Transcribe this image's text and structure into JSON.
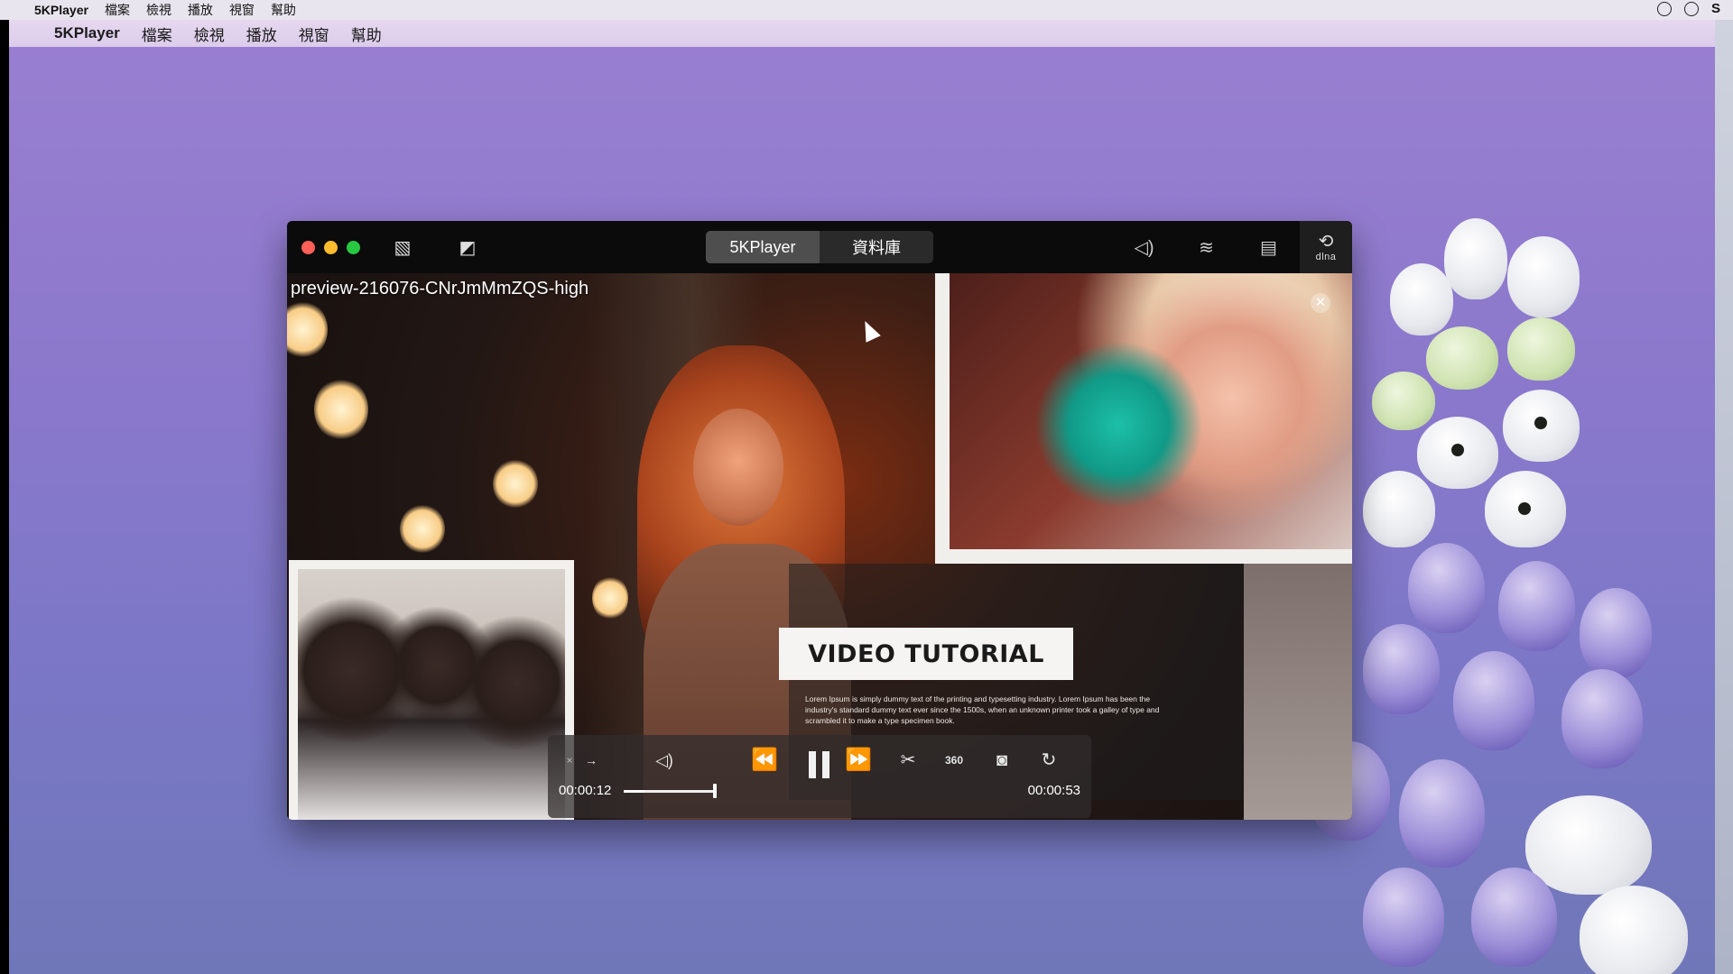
{
  "system_menubar": {
    "apple_icon": "apple-logo-icon",
    "app_name": "5KPlayer",
    "items": [
      "檔案",
      "檢視",
      "播放",
      "視窗",
      "幫助"
    ]
  },
  "inner_menubar": {
    "apple_icon": "apple-logo-icon",
    "app_name": "5KPlayer",
    "items": [
      "檔案",
      "檢視",
      "播放",
      "視窗",
      "幫助"
    ]
  },
  "player": {
    "tabs": [
      "5KPlayer",
      "資料庫"
    ],
    "active_tab": "5KPlayer",
    "dlna_label": "dlna",
    "filename": "preview-216076-CNrJmMmZQS-high",
    "video_overlay": {
      "title": "VIDEO TUTORIAL",
      "body": "Lorem Ipsum is simply dummy text of the printing and typesetting industry. Lorem Ipsum has been the industry's standard dummy text ever since the 1500s, when an unknown printer took a galley of type and scrambled it to make a type specimen book."
    },
    "controls": {
      "current_time": "00:00:12",
      "total_time": "00:00:53",
      "progress_fraction": 0.23,
      "speed_minus": "×",
      "speed_plus": "→",
      "icons": [
        "volume-icon",
        "rewind-icon",
        "pause-icon",
        "fast-forward-icon",
        "cut-icon",
        "360-icon",
        "snapshot-icon",
        "rotate-icon"
      ],
      "label_360": "360"
    }
  },
  "colors": {
    "traffic_red": "#ff5f57",
    "traffic_yellow": "#febc2e",
    "traffic_green": "#28c840",
    "titlebar_bg": "#0b0b0b"
  }
}
